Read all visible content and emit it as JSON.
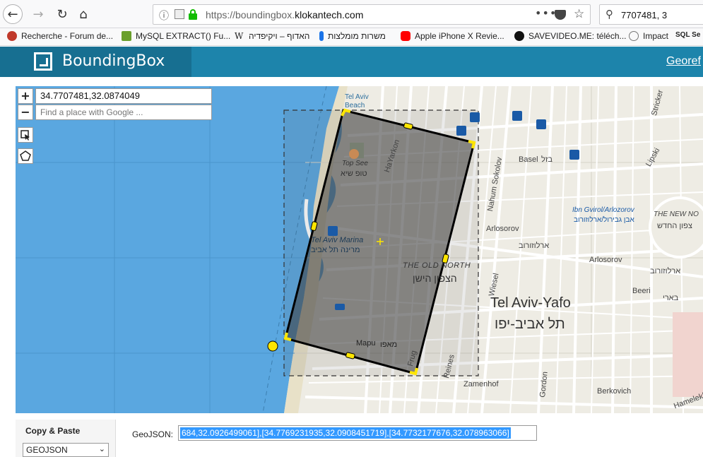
{
  "browser": {
    "url_prefix": "https://boundingbox.",
    "url_domain": "klokantech.com",
    "search_query": "7707481,  3"
  },
  "bookmarks": [
    {
      "label": "Recherche - Forum de...",
      "color": "#c0392b"
    },
    {
      "label": "MySQL EXTRACT() Fu...",
      "color": "#6a9f2c"
    },
    {
      "label": "האדוף – ויקיפדיה",
      "color": "#444444"
    },
    {
      "label": "משרות מומלצות",
      "color": "#1a73e8"
    },
    {
      "label": "Apple iPhone X Revie...",
      "color": "#ff0000"
    },
    {
      "label": "SAVEVIDEO.ME: téléch...",
      "color": "#111111"
    },
    {
      "label": "Impact",
      "color": "#555555"
    },
    {
      "label": "SQL Se",
      "color": "#555555"
    }
  ],
  "site": {
    "brand": "BoundingBox",
    "nav_link": "Georef"
  },
  "map": {
    "coordinates": "34.7707481,32.0874049",
    "search_placeholder": "Find a place with Google ...",
    "zoom_in": "+",
    "zoom_out": "−",
    "labels": {
      "city_en": "Tel Aviv-Yafo",
      "city_he": "תל אביב-יפו",
      "old_north_en": "THE OLD NORTH",
      "old_north_he": "הצפון הישן",
      "new_north": "THE NEW NO",
      "new_north_he": "צפון החדש",
      "marina": "Tel Aviv Marina",
      "marina_he": "מרינה תל אביב",
      "top_see": "Top See",
      "top_see_he": "טופ שיא",
      "beach": "Tel Aviv Beach",
      "basel": "Basel",
      "basel_he": "בזל",
      "arlosorov": "Arlosorov",
      "arlosorov_he": "ארלוזורוב",
      "beeri": "Beeri",
      "beeri_he": "בארי",
      "bengvirol": "Ibn Gvirol/Arlozorov",
      "bengvirol_he": "אבן גבירול/ארלוזורוב",
      "hayarkon": "HaYarkon",
      "nahum": "Nahum Sokolov",
      "wiesel": "Wiesel",
      "mapu": "Mapu",
      "mapu_he": "מאפו",
      "zamenhof": "Zamenhof",
      "berkovich": "Berkovich",
      "lipski": "Lipski",
      "stricker": "Stricker",
      "frug": "Frug",
      "reines": "Reines",
      "gordon": "Gordon",
      "hamelekh": "Hamelekh"
    }
  },
  "panel": {
    "copy_title": "Copy & Paste",
    "format_selected": "GEOJSON",
    "geo_label": "GeoJSON:",
    "geo_value": "684,32.0926499061],[34.7769231935,32.0908451719],[34.7732177676,32.078963066]"
  },
  "colors": {
    "header": "#1d84ab",
    "brand_bg": "#176f91",
    "water": "#5aa7e0",
    "land": "#eeece4",
    "selection": "#555555",
    "handle": "#ffe600",
    "highlight": "#3399ff"
  }
}
